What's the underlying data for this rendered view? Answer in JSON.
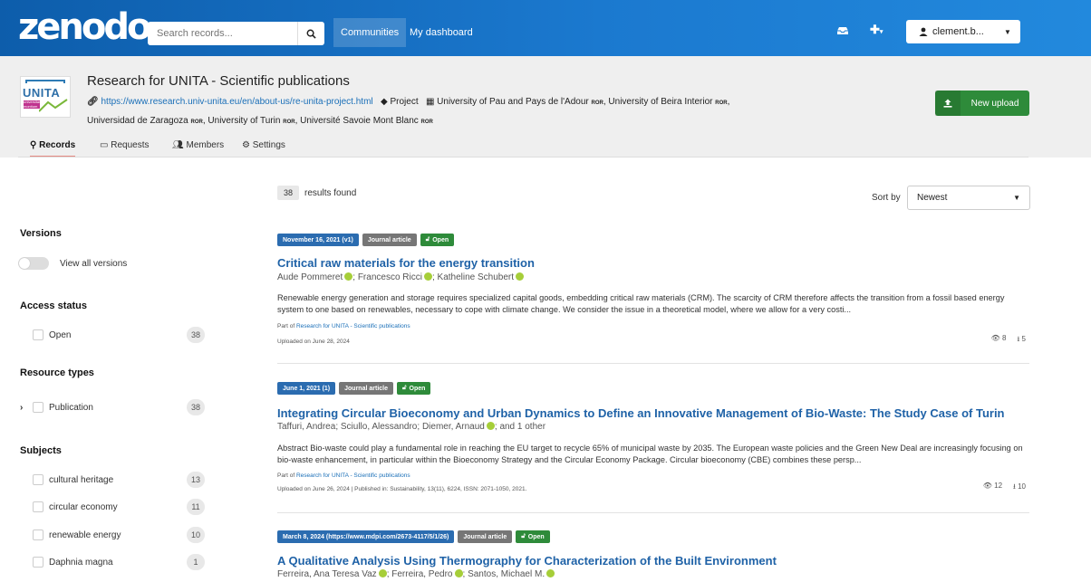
{
  "header": {
    "logo": "zenodo",
    "search_placeholder": "Search records...",
    "nav": {
      "communities": "Communities",
      "dashboard": "My dashboard"
    },
    "user": "clement.b..."
  },
  "community": {
    "logo_text": "UNITA",
    "logo_subtext": "universitas montium",
    "title": "Research for UNITA - Scientific publications",
    "url": "https://www.research.univ-unita.eu/en/about-us/re-unita-project.html",
    "type": "Project",
    "orgs_line1": "University of Pau and Pays de l'Adour",
    "org2": "University of Beira Interior",
    "org3": "Universidad de Zaragoza",
    "org4": "University of Turin",
    "org5": "Université Savoie Mont Blanc",
    "ror": "ROR",
    "new_upload": "New upload",
    "tabs": [
      "Records",
      "Requests",
      "Members",
      "Settings"
    ]
  },
  "facets": {
    "versions": {
      "heading": "Versions",
      "toggle_label": "View all versions"
    },
    "access": {
      "heading": "Access status",
      "items": [
        {
          "label": "Open",
          "count": "38"
        }
      ]
    },
    "resource": {
      "heading": "Resource types",
      "items": [
        {
          "label": "Publication",
          "count": "38"
        }
      ]
    },
    "subjects": {
      "heading": "Subjects",
      "items": [
        {
          "label": "cultural heritage",
          "count": "13"
        },
        {
          "label": "circular economy",
          "count": "11"
        },
        {
          "label": "renewable energy",
          "count": "10"
        },
        {
          "label": "Daphnia magna",
          "count": "1"
        }
      ]
    }
  },
  "results": {
    "count": "38",
    "count_label": "results found",
    "sort_label": "Sort by",
    "sort_value": "Newest",
    "items": [
      {
        "date": "November 16, 2021 (v1)",
        "type": "Journal article",
        "access": "Open",
        "title": "Critical raw materials for the energy transition",
        "authors": [
          "Aude Pommeret",
          "Francesco Ricci",
          "Katheline Schubert"
        ],
        "abstract": "Renewable energy generation and storage requires specialized capital goods, embedding critical raw materials (CRM). The scarcity of CRM therefore affects the transition from a fossil based energy system to one based on renewables, necessary to cope with climate change. We consider the issue in a theoretical model, where we allow for a very costi...",
        "part_of_prefix": "Part of",
        "part_of": "Research for UNITA - Scientific publications",
        "uploaded": "Uploaded on June 28, 2024",
        "views": "8",
        "downloads": "5"
      },
      {
        "date": "June 1, 2021 (1)",
        "type": "Journal article",
        "access": "Open",
        "title": "Integrating Circular Bioeconomy and Urban Dynamics to Define an Innovative Management of Bio-Waste: The Study Case of Turin",
        "authors": [
          "Taffuri, Andrea",
          "Sciullo, Alessandro",
          "Diemer, Arnaud"
        ],
        "authors_more": "and 1 other",
        "abstract": "Abstract Bio-waste could play a fundamental role in reaching the EU target to recycle 65% of municipal waste by 2035. The European waste policies and the Green New Deal are increasingly focusing on bio-waste enhancement, in particular within the Bioeconomy Strategy and the Circular Economy Package. Circular bioeconomy (CBE) combines these persp...",
        "part_of_prefix": "Part of",
        "part_of": "Research for UNITA - Scientific publications",
        "uploaded": "Uploaded on June 26, 2024 | Published in: Sustainability, 13(11), 6224, ISSN: 2071-1050, 2021.",
        "views": "12",
        "downloads": "10"
      },
      {
        "date": "March 8, 2024 (https://www.mdpi.com/2673-4117/5/1/26)",
        "type": "Journal article",
        "access": "Open",
        "title": "A Qualitative Analysis Using Thermography for Characterization of the Built Environment",
        "authors": [
          "Ferreira, Ana Teresa Vaz",
          "Ferreira, Pedro",
          "Santos, Michael M."
        ]
      }
    ]
  }
}
